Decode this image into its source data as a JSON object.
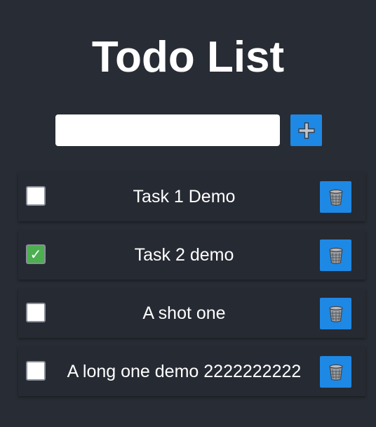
{
  "header": {
    "title": "Todo List"
  },
  "new_task": {
    "value": "",
    "placeholder": "",
    "add_icon": "plus-icon"
  },
  "todos": [
    {
      "text": "Task 1 Demo",
      "completed": false
    },
    {
      "text": "Task 2 demo",
      "completed": true
    },
    {
      "text": "A shot one",
      "completed": false
    },
    {
      "text": "A long one demo 2222222222",
      "completed": false
    }
  ],
  "check_mark": "✓",
  "colors": {
    "background": "#282c34",
    "item_background": "#262a33",
    "accent": "#1e88e5",
    "checked": "#4caf50"
  },
  "icons": {
    "delete": "trash-icon"
  }
}
